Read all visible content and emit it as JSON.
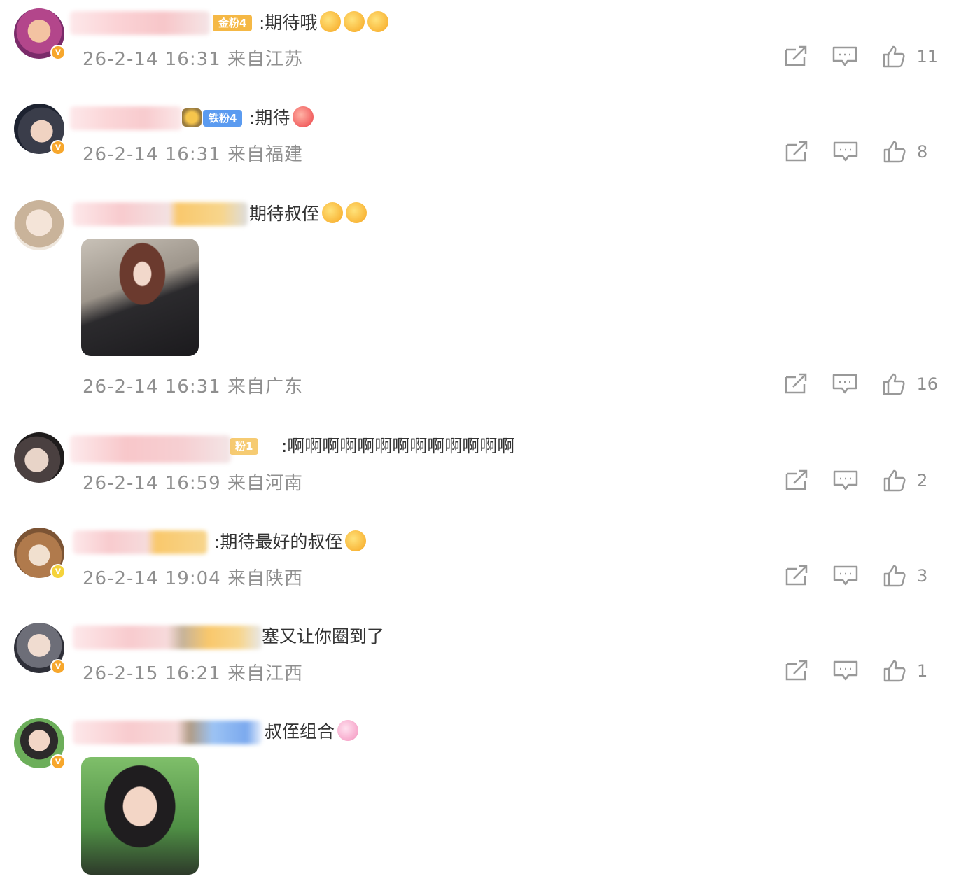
{
  "comments": [
    {
      "fan_badge": "金粉4",
      "text": ":期待哦",
      "time": "26-2-14 16:31",
      "location": "来自江苏",
      "likes": "11"
    },
    {
      "fan_badge": "铁粉4",
      "text": ":期待",
      "time": "26-2-14 16:31",
      "location": "来自福建",
      "likes": "8"
    },
    {
      "fan_badge": "",
      "text": "期待叔侄",
      "time": "26-2-14 16:31",
      "location": "来自广东",
      "likes": "16"
    },
    {
      "fan_badge": "粉1",
      "text": ":啊啊啊啊啊啊啊啊啊啊啊啊啊",
      "time": "26-2-14 16:59",
      "location": "来自河南",
      "likes": "2"
    },
    {
      "fan_badge": "",
      "text": ":期待最好的叔侄",
      "time": "26-2-14 19:04",
      "location": "来自陕西",
      "likes": "3"
    },
    {
      "fan_badge": "",
      "text": "塞又让你圈到了",
      "time": "26-2-15 16:21",
      "location": "来自江西",
      "likes": "1"
    },
    {
      "fan_badge": "",
      "text": "叔侄组合",
      "time": "",
      "location": "",
      "likes": ""
    }
  ],
  "colors": {
    "vip_badge": "#f7a72c",
    "gold_badge": "#f5b845",
    "iron_badge": "#5b9bf0",
    "meta_gray": "#8f8f8f"
  },
  "icons": {
    "share": "share-icon",
    "comment": "comment-icon",
    "like": "like-icon",
    "verified": "verified-badge-icon"
  }
}
